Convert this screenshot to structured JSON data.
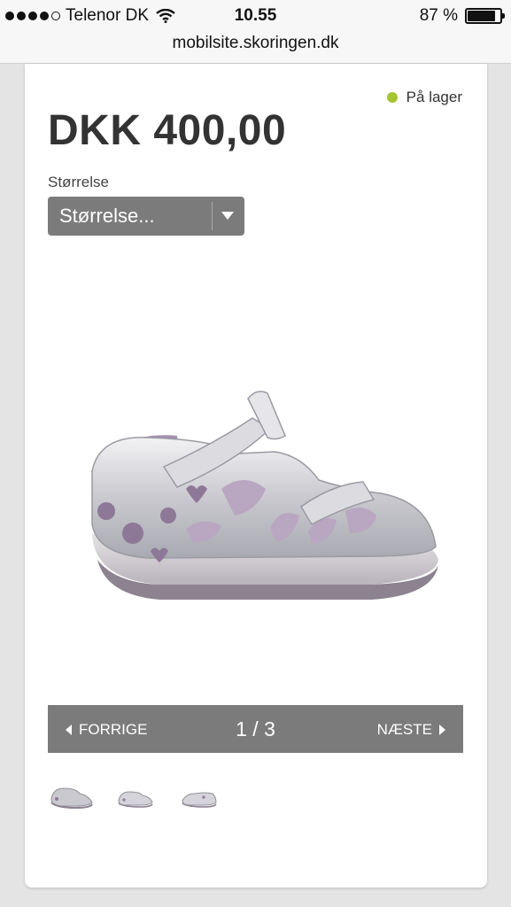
{
  "status_bar": {
    "carrier": "Telenor DK",
    "time": "10.55",
    "battery_percent": "87 %",
    "battery_level": 0.87
  },
  "browser": {
    "url": "mobilsite.skoringen.dk"
  },
  "product": {
    "stock_status": "På lager",
    "stock_color": "#a6c531",
    "price": "DKK 400,00",
    "size_label": "Størrelse",
    "size_select_value": "Størrelse..."
  },
  "gallery": {
    "prev_label": "FORRIGE",
    "next_label": "NÆSTE",
    "counter": "1 / 3",
    "thumbnails": [
      "shoe-thumbnail-1",
      "shoe-thumbnail-2",
      "shoe-thumbnail-3"
    ]
  }
}
